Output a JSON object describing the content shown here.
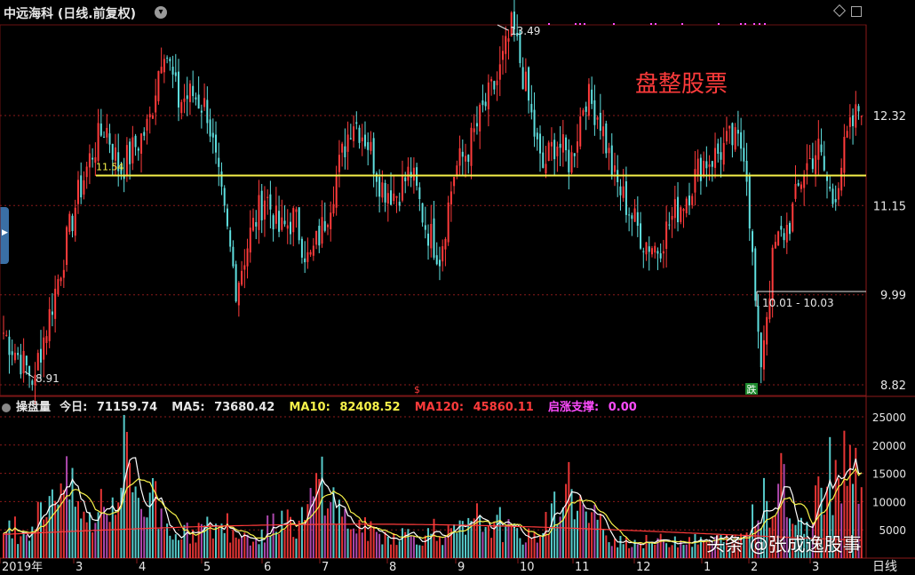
{
  "header": {
    "title": "中远海科 (日线.前复权)",
    "dropdown_icon": "chevron-down-icon",
    "right_icons": [
      "diamond-icon",
      "window-icon"
    ]
  },
  "annotation": "盘整股票",
  "price_panel": {
    "axis_ticks": [
      "12.32",
      "11.15",
      "9.99",
      "8.82"
    ],
    "high_label": "13.49",
    "low_label": "8.91",
    "level_label": "11.54",
    "range_label": "10.01 - 10.03",
    "signal_marks": [
      "$",
      "跌"
    ]
  },
  "volume_panel": {
    "name": "操盘量",
    "today_label": "今日:",
    "today_value": "71159.74",
    "ma5_label": "MA5:",
    "ma5_value": "73680.42",
    "ma10_label": "MA10:",
    "ma10_value": "82408.52",
    "ma120_label": "MA120:",
    "ma120_value": "45860.11",
    "support_label": "启涨支撑:",
    "support_value": "0.00",
    "axis_ticks": [
      "25000",
      "20000",
      "15000",
      "10000",
      "5000"
    ]
  },
  "x_axis": {
    "labels": [
      "2019年",
      "3",
      "4",
      "5",
      "6",
      "7",
      "8",
      "9",
      "10",
      "11",
      "12",
      "1",
      "2",
      "3"
    ],
    "period": "日线"
  },
  "watermark": "头条 @张成逸股事",
  "colors": {
    "up": "#ff3b3b",
    "down": "#5fe0e0",
    "level_line": "#f7f24a",
    "grid": "#8b1a1a",
    "ma5": "#ffffff",
    "ma10": "#f7f24a",
    "ma120": "#ff3b3b",
    "vol_purple": "#c050c0"
  },
  "chart_data": [
    {
      "type": "candlestick",
      "title": "中远海科 (日线.前复权)",
      "y_range": [
        8.82,
        13.5
      ],
      "y_ticks": [
        12.32,
        11.15,
        9.99,
        8.82
      ],
      "annotations": {
        "high": 13.49,
        "low": 8.91,
        "level": 11.54,
        "range": "10.01 - 10.03"
      },
      "close_path": [
        [
          "2019-01",
          9.5
        ],
        [
          "2019-01",
          9.2
        ],
        [
          "2019-01",
          8.91
        ],
        [
          "2019-02",
          9.6
        ],
        [
          "2019-02",
          10.4
        ],
        [
          "2019-02",
          11.2
        ],
        [
          "2019-02",
          11.8
        ],
        [
          "2019-03",
          12.2
        ],
        [
          "2019-03",
          11.6
        ],
        [
          "2019-03",
          11.9
        ],
        [
          "2019-04",
          12.2
        ],
        [
          "2019-04",
          13.3
        ],
        [
          "2019-04",
          12.5
        ],
        [
          "2019-04",
          12.6
        ],
        [
          "2019-04",
          12.4
        ],
        [
          "2019-05",
          11.2
        ],
        [
          "2019-05",
          10.1
        ],
        [
          "2019-05",
          10.8
        ],
        [
          "2019-05",
          11.3
        ],
        [
          "2019-06",
          10.8
        ],
        [
          "2019-06",
          11.0
        ],
        [
          "2019-06",
          10.4
        ],
        [
          "2019-06",
          10.9
        ],
        [
          "2019-07",
          11.6
        ],
        [
          "2019-07",
          12.3
        ],
        [
          "2019-07",
          12.0
        ],
        [
          "2019-07",
          11.4
        ],
        [
          "2019-08",
          11.3
        ],
        [
          "2019-08",
          11.6
        ],
        [
          "2019-08",
          10.9
        ],
        [
          "2019-08",
          10.5
        ],
        [
          "2019-08",
          11.6
        ],
        [
          "2019-09",
          11.9
        ],
        [
          "2019-09",
          12.4
        ],
        [
          "2019-09",
          12.8
        ],
        [
          "2019-09",
          13.49
        ],
        [
          "2019-09",
          12.6
        ],
        [
          "2019-10",
          11.6
        ],
        [
          "2019-10",
          12.0
        ],
        [
          "2019-10",
          11.7
        ],
        [
          "2019-11",
          12.6
        ],
        [
          "2019-11",
          12.3
        ],
        [
          "2019-11",
          11.5
        ],
        [
          "2019-11",
          11.1
        ],
        [
          "2019-12",
          10.7
        ],
        [
          "2019-12",
          10.6
        ],
        [
          "2019-12",
          11.0
        ],
        [
          "2019-12",
          11.3
        ],
        [
          "2020-01",
          11.7
        ],
        [
          "2020-01",
          11.8
        ],
        [
          "2020-01",
          12.0
        ],
        [
          "2020-01",
          11.9
        ],
        [
          "2020-02",
          9.0
        ],
        [
          "2020-02",
          10.6
        ],
        [
          "2020-02",
          10.9
        ],
        [
          "2020-02",
          11.6
        ],
        [
          "2020-03",
          11.9
        ],
        [
          "2020-03",
          11.2
        ],
        [
          "2020-03",
          12.0
        ],
        [
          "2020-03",
          12.5
        ]
      ]
    },
    {
      "type": "bar",
      "title": "操盘量",
      "y_range": [
        0,
        27000
      ],
      "y_ticks": [
        25000,
        20000,
        15000,
        10000,
        5000
      ],
      "series": [
        {
          "name": "今日",
          "value": 71159.74
        },
        {
          "name": "MA5",
          "value": 73680.42
        },
        {
          "name": "MA10",
          "value": 82408.52
        },
        {
          "name": "MA120",
          "value": 45860.11
        },
        {
          "name": "启涨支撑",
          "value": 0.0
        }
      ],
      "volume_path": [
        3500,
        4500,
        5200,
        9500,
        14500,
        11000,
        6200,
        7000,
        11000,
        16500,
        9500,
        8000,
        5500,
        4200,
        4800,
        5500,
        4600,
        5000,
        3800,
        4400,
        4900,
        5200,
        8000,
        15000,
        9000,
        6000,
        5200,
        4200,
        3900,
        4300,
        3700,
        4100,
        4000,
        4800,
        5600,
        6100,
        5200,
        4400,
        3600,
        5000,
        9500,
        13000,
        7500,
        4800,
        3600,
        3100,
        2800,
        2900,
        3200,
        3300,
        3000,
        2800,
        3400,
        2900,
        5200,
        8500,
        12000,
        6500,
        4500,
        9000,
        14000,
        19000,
        15500
      ]
    }
  ]
}
